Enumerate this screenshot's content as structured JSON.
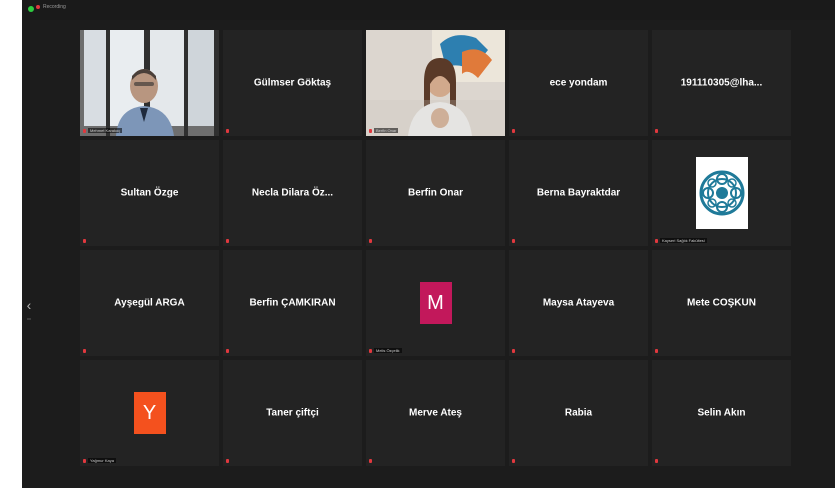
{
  "app": {
    "meeting_label": "Recording",
    "rec_color": "#e0383e",
    "security_color": "#2ecc40",
    "nav_prev_icon": "chevron-left-icon"
  },
  "participants": [
    {
      "name": "",
      "type": "video",
      "chip": "Mehmet Karakoç",
      "video": "man-window"
    },
    {
      "name": "Gülmser Göktaş",
      "type": "name"
    },
    {
      "name": "",
      "type": "video",
      "chip": "Berfin Onar",
      "video": "woman-wall",
      "speaking": true
    },
    {
      "name": "ece yondam",
      "type": "name"
    },
    {
      "name": "191110305@lha...",
      "type": "name"
    },
    {
      "name": "Sultan Özge",
      "type": "name"
    },
    {
      "name": "Necla Dilara Öz...",
      "type": "name"
    },
    {
      "name": "Berfin Onar",
      "type": "name"
    },
    {
      "name": "Berna Bayraktdar",
      "type": "name"
    },
    {
      "name": "",
      "type": "logo",
      "chip": "Kayseri Sağlık Fakültesi"
    },
    {
      "name": "Ayşegül ARGA",
      "type": "name"
    },
    {
      "name": "Berfin ÇAMKIRAN",
      "type": "name"
    },
    {
      "name": "",
      "type": "avatar",
      "letter": "M",
      "color": "#c2185b",
      "chip": "Melis Özçelik"
    },
    {
      "name": "Maysa Atayeva",
      "type": "name"
    },
    {
      "name": "Mete COŞKUN",
      "type": "name"
    },
    {
      "name": "",
      "type": "avatar",
      "letter": "Y",
      "color": "#f4511e",
      "chip": "Yağmur Kaya"
    },
    {
      "name": "Taner çiftçi",
      "type": "name"
    },
    {
      "name": "Merve Ateş",
      "type": "name"
    },
    {
      "name": "Rabia",
      "type": "name"
    },
    {
      "name": "Selin Akın",
      "type": "name"
    }
  ]
}
